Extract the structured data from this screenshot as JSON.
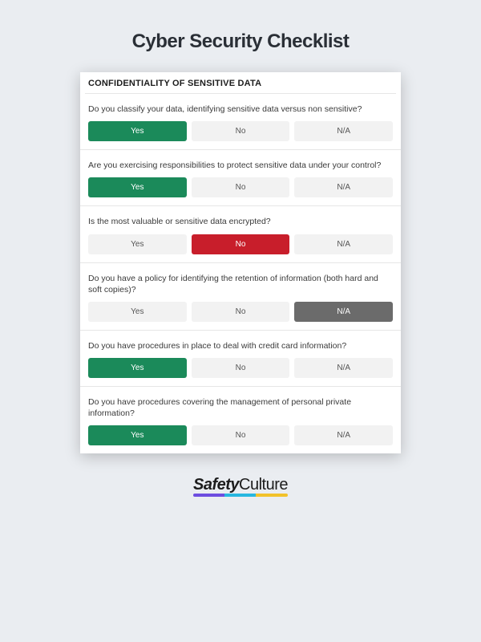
{
  "title": "Cyber Security Checklist",
  "section_header": "CONFIDENTIALITY OF SENSITIVE DATA",
  "answers": {
    "yes": "Yes",
    "no": "No",
    "na": "N/A"
  },
  "questions": [
    {
      "text": "Do you classify your data, identifying sensitive data versus non sensitive?",
      "selected": "yes"
    },
    {
      "text": "Are you exercising responsibilities to protect sensitive data under your control?",
      "selected": "yes"
    },
    {
      "text": "Is the most valuable or sensitive data encrypted?",
      "selected": "no"
    },
    {
      "text": "Do you have a policy for identifying the retention of information (both hard and soft copies)?",
      "selected": "na"
    },
    {
      "text": "Do you have procedures in place to deal with credit card information?",
      "selected": "yes"
    },
    {
      "text": "Do you have procedures covering the management of personal private information?",
      "selected": "yes"
    }
  ],
  "logo": {
    "part1": "Safety",
    "part2": "Culture"
  }
}
